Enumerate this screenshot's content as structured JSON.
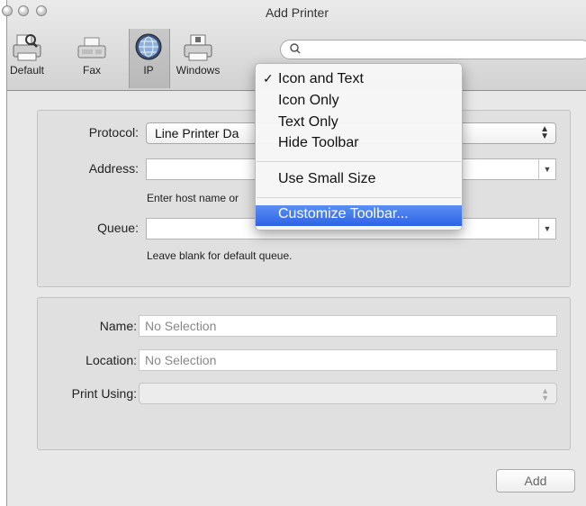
{
  "window": {
    "title": "Add Printer"
  },
  "toolbar": {
    "items": [
      {
        "label": "Default",
        "icon": "printer-search-icon"
      },
      {
        "label": "Fax",
        "icon": "fax-icon"
      },
      {
        "label": "IP",
        "icon": "globe-icon"
      },
      {
        "label": "Windows",
        "icon": "printer-windows-icon"
      }
    ],
    "selected": "IP",
    "search": {
      "placeholder": "",
      "icon": "search-icon"
    }
  },
  "context_menu": {
    "items": [
      {
        "label": "Icon and Text",
        "checked": true
      },
      {
        "label": "Icon Only"
      },
      {
        "label": "Text Only"
      },
      {
        "label": "Hide Toolbar"
      },
      {
        "label": "Use Small Size"
      },
      {
        "label": "Customize Toolbar..."
      }
    ],
    "highlighted": "Customize Toolbar..."
  },
  "form": {
    "protocol": {
      "label": "Protocol:",
      "value": "Line Printer Da"
    },
    "address": {
      "label": "Address:",
      "value": "",
      "hint": "Enter host name or"
    },
    "queue": {
      "label": "Queue:",
      "value": "",
      "hint": "Leave blank for default queue."
    }
  },
  "details": {
    "name": {
      "label": "Name:",
      "value": "No Selection"
    },
    "location": {
      "label": "Location:",
      "value": "No Selection"
    },
    "print_using": {
      "label": "Print Using:",
      "value": ""
    }
  },
  "buttons": {
    "add": "Add"
  },
  "colors": {
    "accent": "#2d63e6",
    "window_bg": "#e8e8e8"
  }
}
